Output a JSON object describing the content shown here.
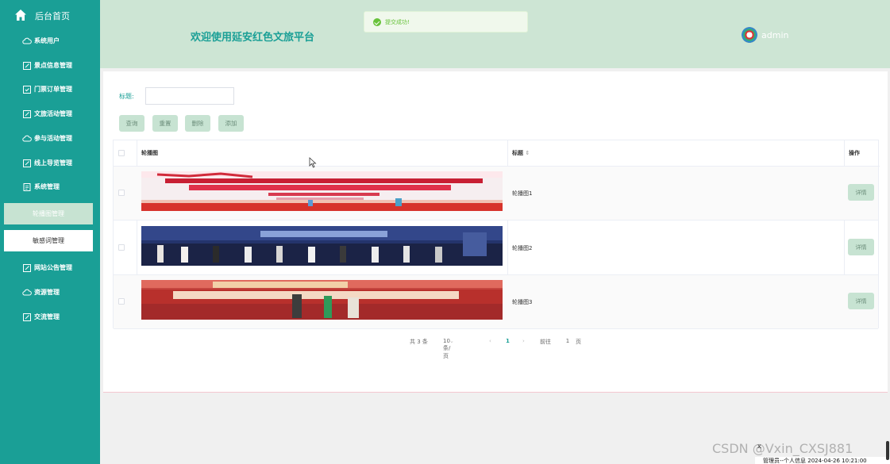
{
  "sidebar": {
    "home_label": "后台首页",
    "items": [
      {
        "label": "系统用户",
        "icon": "cloud-icon"
      },
      {
        "label": "景点信息管理",
        "icon": "edit-icon"
      },
      {
        "label": "门票订单管理",
        "icon": "ticket-icon"
      },
      {
        "label": "文旅活动管理",
        "icon": "edit-icon"
      },
      {
        "label": "参与活动管理",
        "icon": "cloud-icon"
      },
      {
        "label": "线上导览管理",
        "icon": "edit-icon"
      },
      {
        "label": "系统管理",
        "icon": "doc-icon"
      },
      {
        "label": "网站公告管理",
        "icon": "edit-icon"
      },
      {
        "label": "资源管理",
        "icon": "cloud-icon"
      },
      {
        "label": "交流管理",
        "icon": "edit-icon"
      }
    ],
    "sub_items": [
      "轮播图管理",
      "敏感词管理"
    ]
  },
  "header": {
    "title": "欢迎使用延安红色文旅平台",
    "username": "admin"
  },
  "toast": {
    "message": "提交成功!"
  },
  "search": {
    "label": "标题:",
    "value": "",
    "placeholder": ""
  },
  "buttons": {
    "query": "查询",
    "reset": "重置",
    "delete": "删除",
    "add": "添加"
  },
  "table": {
    "headers": {
      "image": "轮播图",
      "title": "标题",
      "sort_icon": "⇕",
      "actions": "操作"
    },
    "rows": [
      {
        "title": "轮播图1",
        "detail": "详情"
      },
      {
        "title": "轮播图2",
        "detail": "详情"
      },
      {
        "title": "轮播图3",
        "detail": "详情"
      }
    ]
  },
  "pagination": {
    "total": "共 3 条",
    "page_size": "10条/页",
    "current_page": "1",
    "goto_prefix": "前往",
    "goto_value": "1",
    "goto_suffix": "页"
  },
  "watermark": {
    "text": "CSDN @Vxin_CXSJ881",
    "close": "x",
    "bar_text": "管理员--个人信息 2024-04-26 10:21:00"
  },
  "colors": {
    "accent": "#1a9f96",
    "header_bg": "#cde5d4",
    "button_bg": "#c7e3d2",
    "success": "#67c23a"
  }
}
